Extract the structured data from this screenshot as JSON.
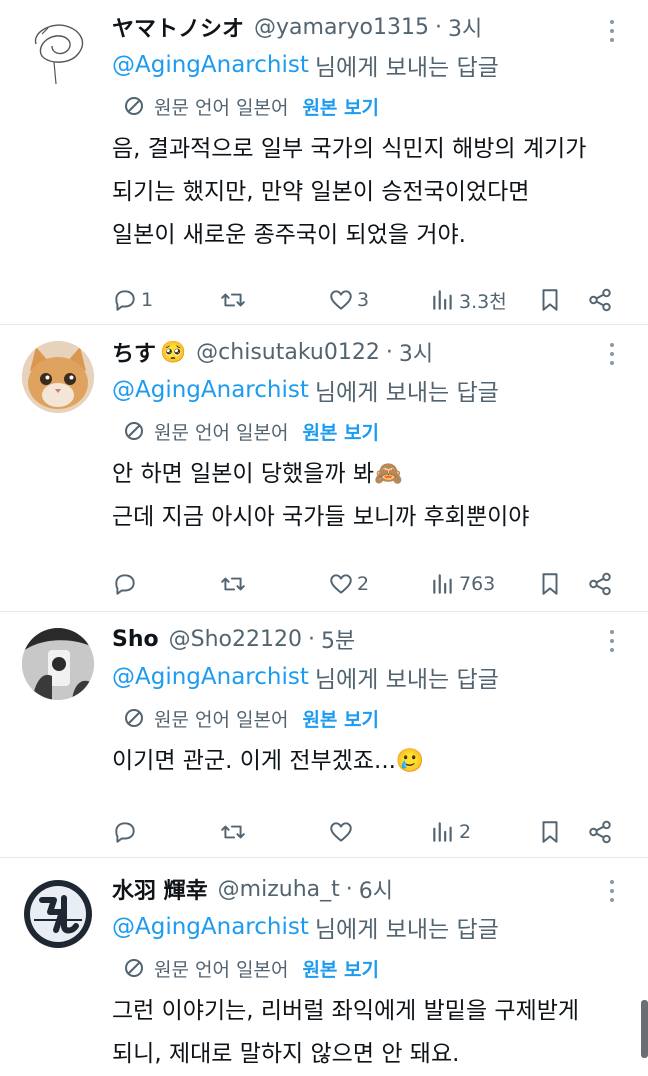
{
  "common": {
    "reply_prefix": "@AgingAnarchist",
    "reply_suffix": "님에게 보내는 답글",
    "translate_note": "원문 언어 일본어",
    "show_original": "원본 보기",
    "separator": "·"
  },
  "tweets": [
    {
      "name": "ヤマトノシオ",
      "handle": "@yamaryo1315",
      "time": "3시",
      "lines": [
        "음, 결과적으로 일부 국가의 식민지 해방의 계기가",
        "되기는 했지만, 만약 일본이 승전국이었다면",
        "일본이 새로운 종주국이 되었을 거야."
      ],
      "replies": "1",
      "retweets": "",
      "likes": "3",
      "views": "3.3천"
    },
    {
      "name": "ちす",
      "name_emoji": "🥺",
      "handle": "@chisutaku0122",
      "time": "3시",
      "lines": [
        "안 하면 일본이 당했을까 봐🙈",
        "근데 지금 아시아 국가들 보니까 후회뿐이야"
      ],
      "replies": "",
      "retweets": "",
      "likes": "2",
      "views": "763"
    },
    {
      "name": "Sho",
      "handle": "@Sho22120",
      "time": "5분",
      "lines": [
        "이기면 관군. 이게 전부겠죠...🥲"
      ],
      "replies": "",
      "retweets": "",
      "likes": "",
      "views": "2"
    },
    {
      "name": "水羽 輝幸",
      "handle": "@mizuha_t",
      "time": "6시",
      "lines": [
        "그런 이야기는, 리버럴 좌익에게 발밑을 구제받게",
        "되니, 제대로 말하지 않으면 안 돼요."
      ]
    }
  ],
  "colors": {
    "link": "#1d9bf0",
    "secondary_text": "#536471",
    "primary_text": "#0f1419",
    "divider": "#e6e9eb"
  },
  "icons": [
    "reply-icon",
    "retweet-icon",
    "like-icon",
    "views-icon",
    "bookmark-icon",
    "share-icon",
    "translate-icon",
    "more-icon"
  ]
}
